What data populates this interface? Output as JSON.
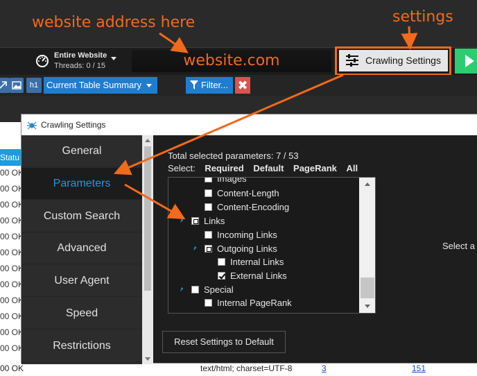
{
  "annotations": {
    "website_note": "website address here",
    "settings_note": "settings"
  },
  "toolbar": {
    "scope_title": "Entire Website",
    "threads": "Threads: 0 / 15",
    "address_value": "website.com",
    "crawling_settings_label": "Crawling Settings",
    "h1_label": "h1",
    "table_summary_label": "Current Table Summary",
    "filter_label": "Filter...",
    "clear_label": "✖"
  },
  "background_table": {
    "status_header": "Statu",
    "status_values": [
      "00 OK",
      "00 OK",
      "00 OK",
      "00 OK",
      "00 OK",
      "00 OK",
      "00 OK",
      "00 OK",
      "00 OK",
      "00 OK",
      "00 OK",
      "00 OK"
    ],
    "bottom_row": {
      "status": "00 OK",
      "content_type": "text/html; charset=UTF-8",
      "count_a": "3",
      "count_b": "151"
    }
  },
  "dialog": {
    "title": "Crawling Settings",
    "nav": [
      "General",
      "Parameters",
      "Custom Search",
      "Advanced",
      "User Agent",
      "Speed",
      "Restrictions"
    ],
    "active_nav": "Parameters",
    "params_summary": "Total selected parameters: 7 / 53",
    "select_label": "Select:",
    "select_options": [
      "Required",
      "Default",
      "PageRank",
      "All"
    ],
    "tree": {
      "images": "Images",
      "content_length": "Content-Length",
      "content_encoding": "Content-Encoding",
      "links": "Links",
      "incoming_links": "Incoming Links",
      "outgoing_links": "Outgoing Links",
      "internal_links": "Internal Links",
      "external_links": "External Links",
      "special": "Special",
      "internal_pagerank": "Internal PageRank"
    },
    "select_prompt": "Select a",
    "reset_label": "Reset Settings to Default"
  },
  "colors": {
    "accent_orange": "#f26a1b",
    "accent_blue": "#1f9bde",
    "start_green": "#2ecc71",
    "clear_red": "#d9534f"
  }
}
